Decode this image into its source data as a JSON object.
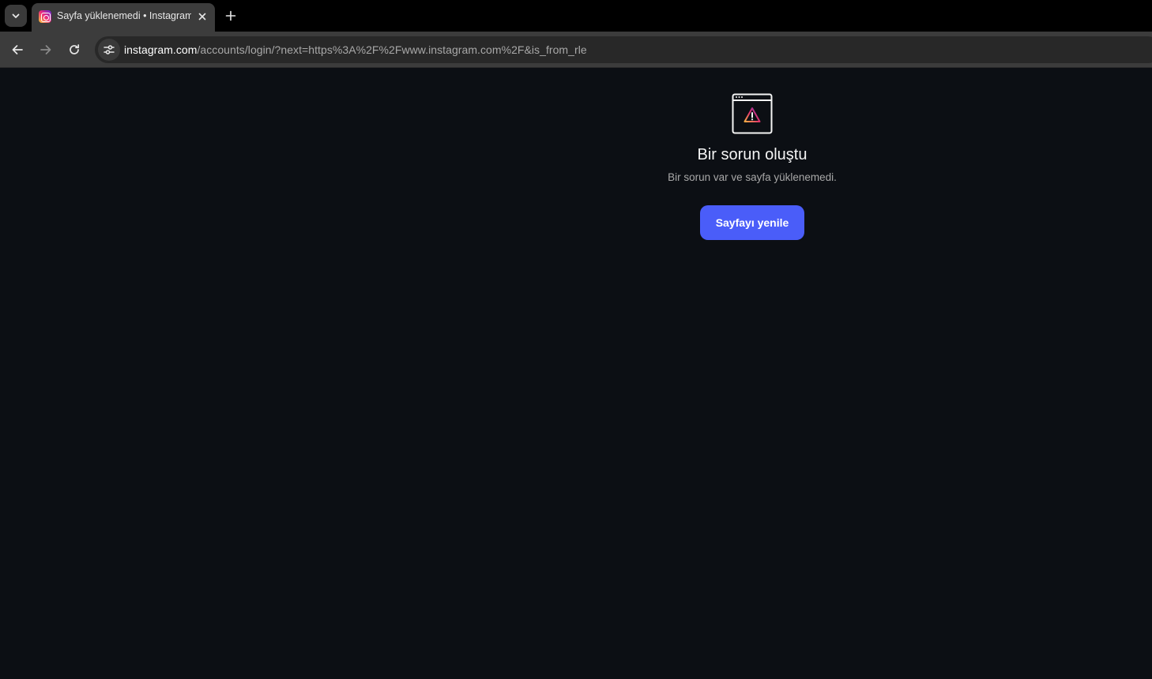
{
  "browser": {
    "tab": {
      "title": "Sayfa yüklenemedi • Instagram",
      "favicon": "instagram-icon"
    },
    "address_bar": {
      "host": "instagram.com",
      "path": "/accounts/login/?next=https%3A%2F%2Fwww.instagram.com%2F&is_from_rle"
    },
    "icons": {
      "tab_search": "chevron-down-icon",
      "tab_close": "close-icon",
      "new_tab": "plus-icon",
      "back": "arrow-left-icon",
      "forward": "arrow-right-icon",
      "reload": "reload-icon",
      "site_info": "tune-icon"
    }
  },
  "error_page": {
    "illustration": "browser-warning-icon",
    "title": "Bir sorun oluştu",
    "subtitle": "Bir sorun var ve sayfa yüklenemedi.",
    "reload_button": "Sayfayı yenile"
  },
  "colors": {
    "page_background": "#0c0f14",
    "primary_button": "#4a5df9",
    "browser_chrome": "#3c3c3c",
    "tab_strip": "#000000"
  }
}
